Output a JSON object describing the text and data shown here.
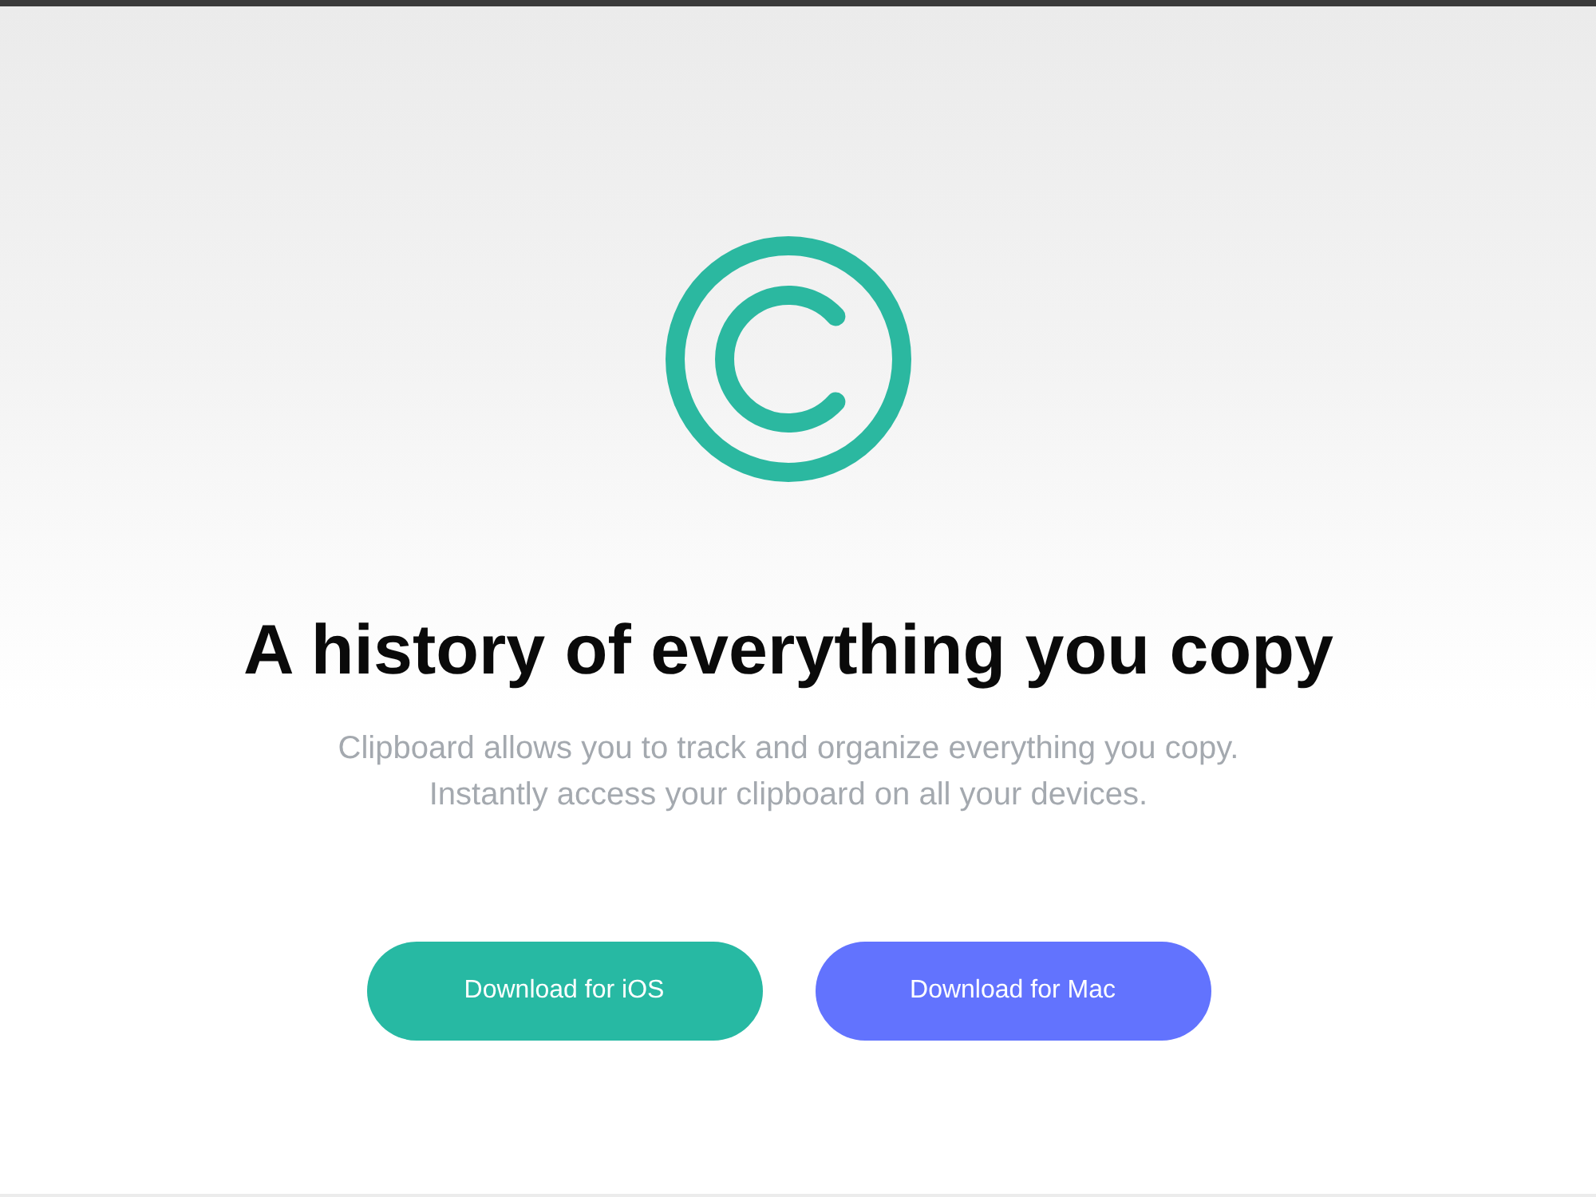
{
  "heading": "A history of everything you copy",
  "description": "Clipboard allows you to track and organize everything you copy. Instantly access your clipboard on all your devices.",
  "buttons": [
    {
      "label": "Download for iOS",
      "color": "#27b9a3"
    },
    {
      "label": "Download for Mac",
      "color": "#6273fe"
    }
  ]
}
